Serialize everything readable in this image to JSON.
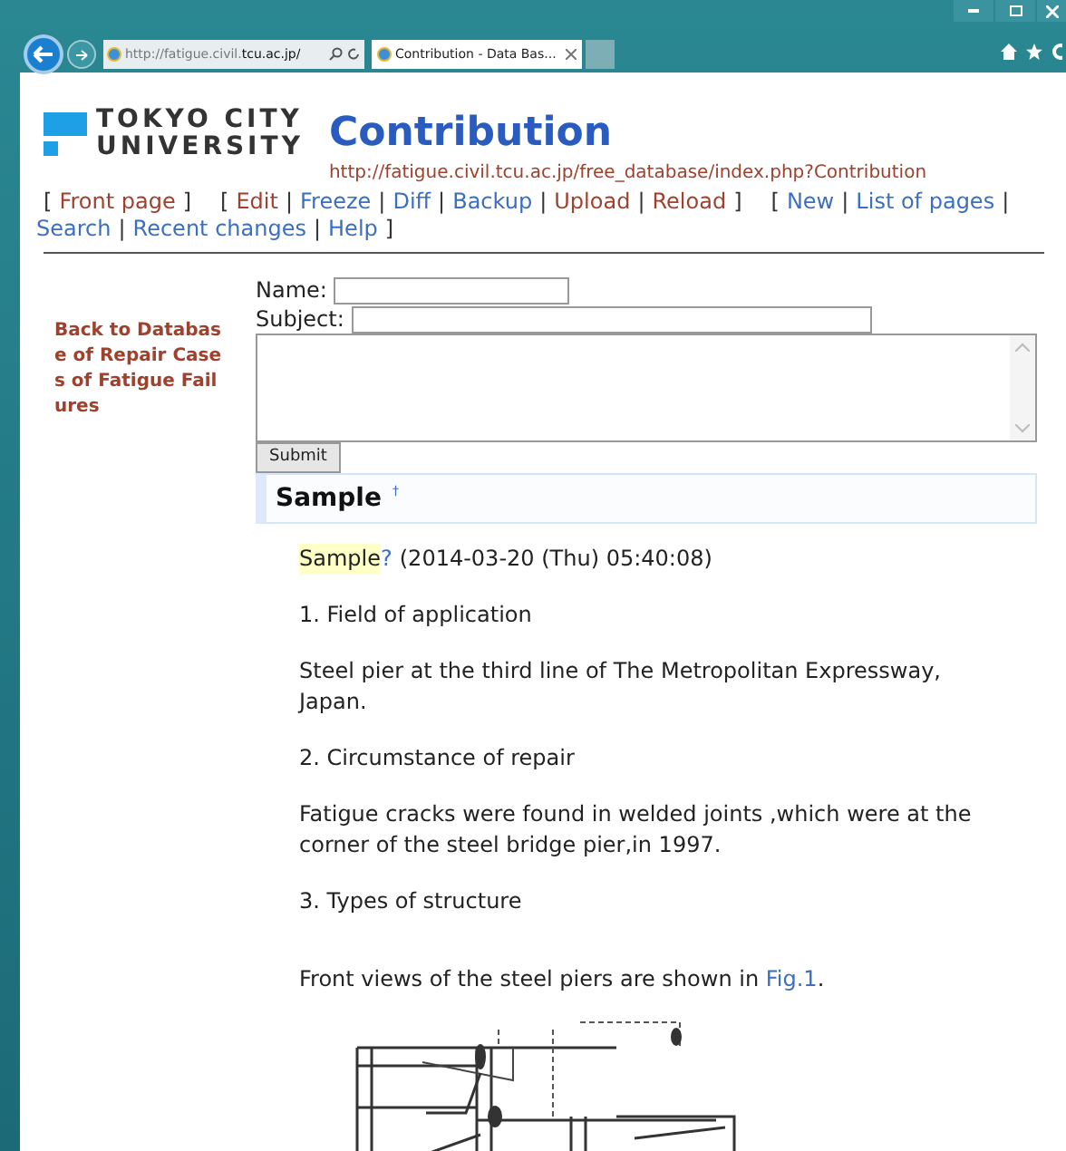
{
  "browser": {
    "address_host": "http://fatigue.civil.",
    "address_domain": "tcu.ac.jp/",
    "tab_title": "Contribution - Data Bas..."
  },
  "logo": {
    "line1": "TOKYO CITY",
    "line2": "UNIVERSITY"
  },
  "page": {
    "title": "Contribution",
    "url": "http://fatigue.civil.tcu.ac.jp/free_database/index.php?Contribution"
  },
  "nav": [
    {
      "kind": "text",
      "text": "["
    },
    {
      "kind": "link",
      "text": "Front page",
      "visited": true
    },
    {
      "kind": "text",
      "text": "]"
    },
    {
      "kind": "gap"
    },
    {
      "kind": "text",
      "text": "["
    },
    {
      "kind": "link",
      "text": "Edit",
      "visited": true
    },
    {
      "kind": "text",
      "text": "|"
    },
    {
      "kind": "link",
      "text": "Freeze",
      "visited": false
    },
    {
      "kind": "text",
      "text": "|"
    },
    {
      "kind": "link",
      "text": "Diff",
      "visited": false
    },
    {
      "kind": "text",
      "text": "|"
    },
    {
      "kind": "link",
      "text": "Backup",
      "visited": false
    },
    {
      "kind": "text",
      "text": "|"
    },
    {
      "kind": "link",
      "text": "Upload",
      "visited": true
    },
    {
      "kind": "text",
      "text": "|"
    },
    {
      "kind": "link",
      "text": "Reload",
      "visited": true
    },
    {
      "kind": "text",
      "text": "]"
    },
    {
      "kind": "gap"
    },
    {
      "kind": "text",
      "text": "["
    },
    {
      "kind": "link",
      "text": "New",
      "visited": false
    },
    {
      "kind": "text",
      "text": "|"
    },
    {
      "kind": "link",
      "text": "List of pages",
      "visited": false
    },
    {
      "kind": "text",
      "text": "|"
    },
    {
      "kind": "break"
    },
    {
      "kind": "link",
      "text": "Search",
      "visited": false
    },
    {
      "kind": "text",
      "text": "|"
    },
    {
      "kind": "link",
      "text": "Recent changes",
      "visited": false
    },
    {
      "kind": "text",
      "text": "|"
    },
    {
      "kind": "link",
      "text": "Help",
      "visited": false
    },
    {
      "kind": "text",
      "text": "]"
    }
  ],
  "sidebar_link": "Back to Database of Repair Cases of Fatigue Failures",
  "form": {
    "name_label": "Name:",
    "subject_label": "Subject:",
    "submit": "Submit"
  },
  "section": {
    "heading": "Sample",
    "anchor": "†"
  },
  "post": {
    "author": "Sample",
    "author_mark": "?",
    "date": "(2014-03-20 (Thu) 05:40:08)"
  },
  "paragraphs": [
    {
      "text": "1. Field of application"
    },
    {
      "text": "Steel pier at the third line of The Metropolitan Expressway, Japan."
    },
    {
      "text": "2. Circumstance of repair"
    },
    {
      "text": "Fatigue cracks were found in welded joints ,which were at the corner of the steel bridge pier,in 1997."
    },
    {
      "text": "3. Types of structure"
    },
    {
      "text": "Front views of the steel piers are shown in ",
      "link": "Fig.1",
      "after": "."
    }
  ]
}
